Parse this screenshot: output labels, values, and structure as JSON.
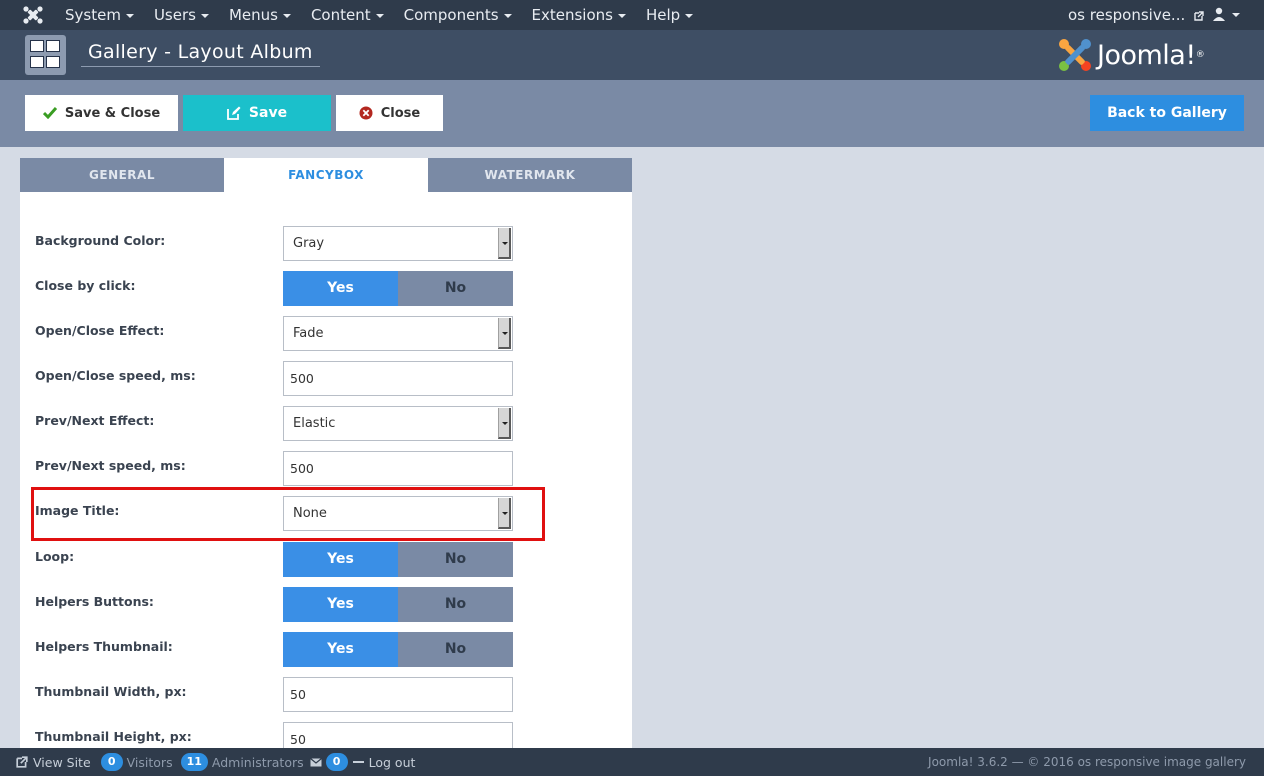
{
  "navbar": {
    "menu": [
      "System",
      "Users",
      "Menus",
      "Content",
      "Components",
      "Extensions",
      "Help"
    ],
    "site_name": "os responsive..."
  },
  "header": {
    "title": "Gallery - Layout Album",
    "brand": "Joomla!",
    "brand_mark": "®"
  },
  "toolbar": {
    "save_close": "Save & Close",
    "save": "Save",
    "close": "Close",
    "back": "Back to Gallery"
  },
  "tabs": [
    "GENERAL",
    "FANCYBOX",
    "WATERMARK"
  ],
  "active_tab": "FANCYBOX",
  "form": {
    "background_color": {
      "label": "Background Color:",
      "value": "Gray"
    },
    "close_by_click": {
      "label": "Close by click:",
      "yes": "Yes",
      "no": "No",
      "selected": "Yes"
    },
    "open_close_effect": {
      "label": "Open/Close Effect:",
      "value": "Fade"
    },
    "open_close_speed": {
      "label": "Open/Close speed, ms:",
      "value": "500"
    },
    "prev_next_effect": {
      "label": "Prev/Next Effect:",
      "value": "Elastic"
    },
    "prev_next_speed": {
      "label": "Prev/Next speed, ms:",
      "value": "500"
    },
    "image_title": {
      "label": "Image Title:",
      "value": "None"
    },
    "loop": {
      "label": "Loop:",
      "yes": "Yes",
      "no": "No",
      "selected": "Yes"
    },
    "helpers_buttons": {
      "label": "Helpers Buttons:",
      "yes": "Yes",
      "no": "No",
      "selected": "Yes"
    },
    "helpers_thumbnail": {
      "label": "Helpers Thumbnail:",
      "yes": "Yes",
      "no": "No",
      "selected": "Yes"
    },
    "thumbnail_width": {
      "label": "Thumbnail Width, px:",
      "value": "50"
    },
    "thumbnail_height": {
      "label": "Thumbnail Height, px:",
      "value": "50"
    }
  },
  "statusbar": {
    "view_site": "View Site",
    "visitors_count": "0",
    "visitors_label": "Visitors",
    "admins_count": "11",
    "admins_label": "Administrators",
    "messages_count": "0",
    "logout": "Log out",
    "footer": "Joomla! 3.6.2 — © 2016 os responsive image gallery"
  },
  "colors": {
    "navbar": "#2f3b4b",
    "header": "#3e4e64",
    "toolbar": "#7a8aa5",
    "accent_blue": "#2d8ee0",
    "save_teal": "#1bc0cb",
    "highlight_red": "#e01010"
  },
  "icons": {
    "navbar_logo": "joomla-logo-icon",
    "external": "external-link-icon",
    "user": "user-icon",
    "gallery": "gallery-icon",
    "save_close": "checkmark-icon",
    "save": "edit-icon",
    "close": "close-circle-icon"
  }
}
